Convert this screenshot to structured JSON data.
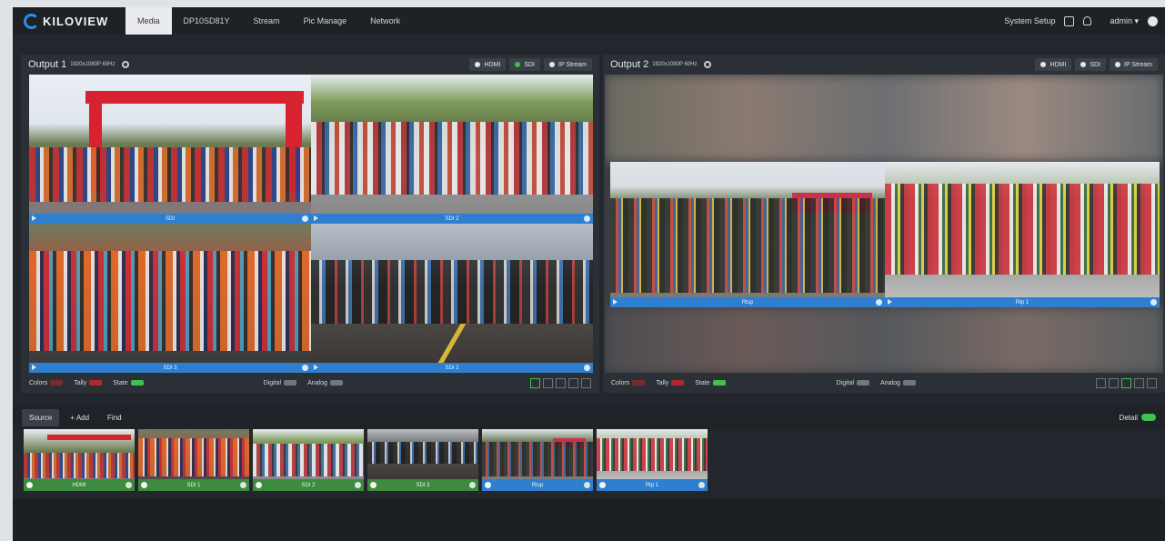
{
  "app": {
    "logo": "KILOVIEW",
    "nav": [
      "Media",
      "DP10SD81Y",
      "Stream",
      "Pic Manage",
      "Network"
    ],
    "active_nav": "Media",
    "system_setup": "System Setup",
    "user": "admin"
  },
  "output1": {
    "title": "Output 1",
    "resolution": "1920x1080P 60Hz",
    "buttons": [
      "HDMI",
      "SDI",
      "IP Stream"
    ],
    "active_button": "SDI",
    "tiles": [
      "SDI",
      "SDI 2",
      "SDI 3",
      "SDI 2"
    ],
    "footer": {
      "colors": "Colors",
      "tally": "Tally",
      "state": "State",
      "digital": "Digital",
      "analog": "Analog"
    }
  },
  "output2": {
    "title": "Output 2",
    "resolution": "1920x1080P 60Hz",
    "buttons": [
      "HDMI",
      "SDI",
      "IP Stream"
    ],
    "tiles": [
      "Rtsp",
      "Rtp 1"
    ],
    "footer": {
      "colors": "Colors",
      "tally": "Tally",
      "state": "State",
      "digital": "Digital",
      "analog": "Analog"
    }
  },
  "source": {
    "tabs": [
      "Source",
      "+ Add",
      "Find"
    ],
    "detail": "Detail",
    "thumbs": [
      {
        "label": "HDMI",
        "color": "#3c8b3f"
      },
      {
        "label": "SDI 1",
        "color": "#3c8b3f"
      },
      {
        "label": "SDI 2",
        "color": "#3c8b3f"
      },
      {
        "label": "SDI 3",
        "color": "#3c8b3f"
      },
      {
        "label": "Rtsp",
        "color": "#2f7fd1"
      },
      {
        "label": "Rtp 1",
        "color": "#2f7fd1"
      }
    ]
  },
  "colors": {
    "accent_blue": "#2f7fd1",
    "accent_green": "#3ec14f",
    "tally_red": "#b3262f"
  }
}
